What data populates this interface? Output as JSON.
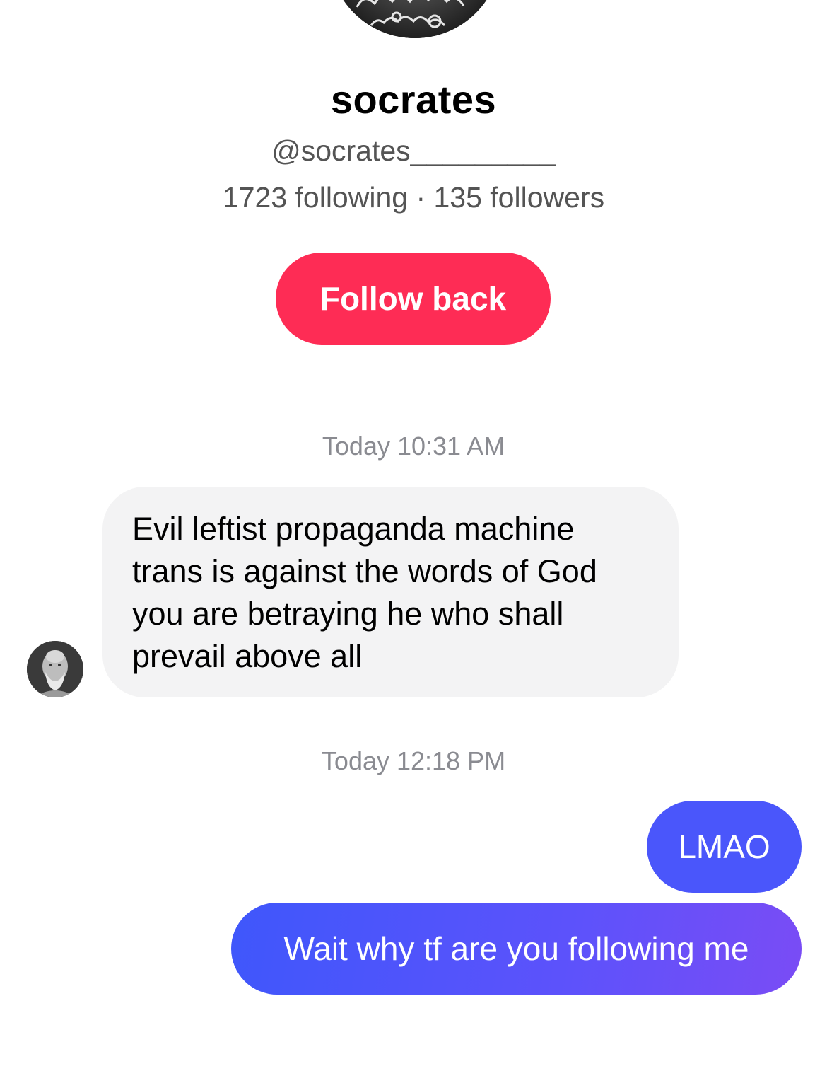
{
  "profile": {
    "name": "socrates",
    "handle": "@socrates_________",
    "stats": "1723 following · 135 followers",
    "follow_label": "Follow back",
    "avatar_icon": "socrates-bust-avatar-icon"
  },
  "messages": [
    {
      "timestamp": "Today 10:31 AM",
      "direction": "incoming",
      "text": "Evil leftist propaganda machine trans is against the words of God you are betraying he who shall prevail above all"
    },
    {
      "timestamp": "Today 12:18 PM",
      "direction": "outgoing",
      "text": "LMAO"
    },
    {
      "direction": "outgoing",
      "text": "Wait why tf are you following me"
    }
  ],
  "colors": {
    "follow_button": "#fe2c55",
    "incoming_bubble": "#f3f3f4",
    "outgoing_bubble_start": "#3f57fb",
    "outgoing_bubble_end": "#7a4cf5",
    "timestamp_text": "#8a8b91"
  }
}
